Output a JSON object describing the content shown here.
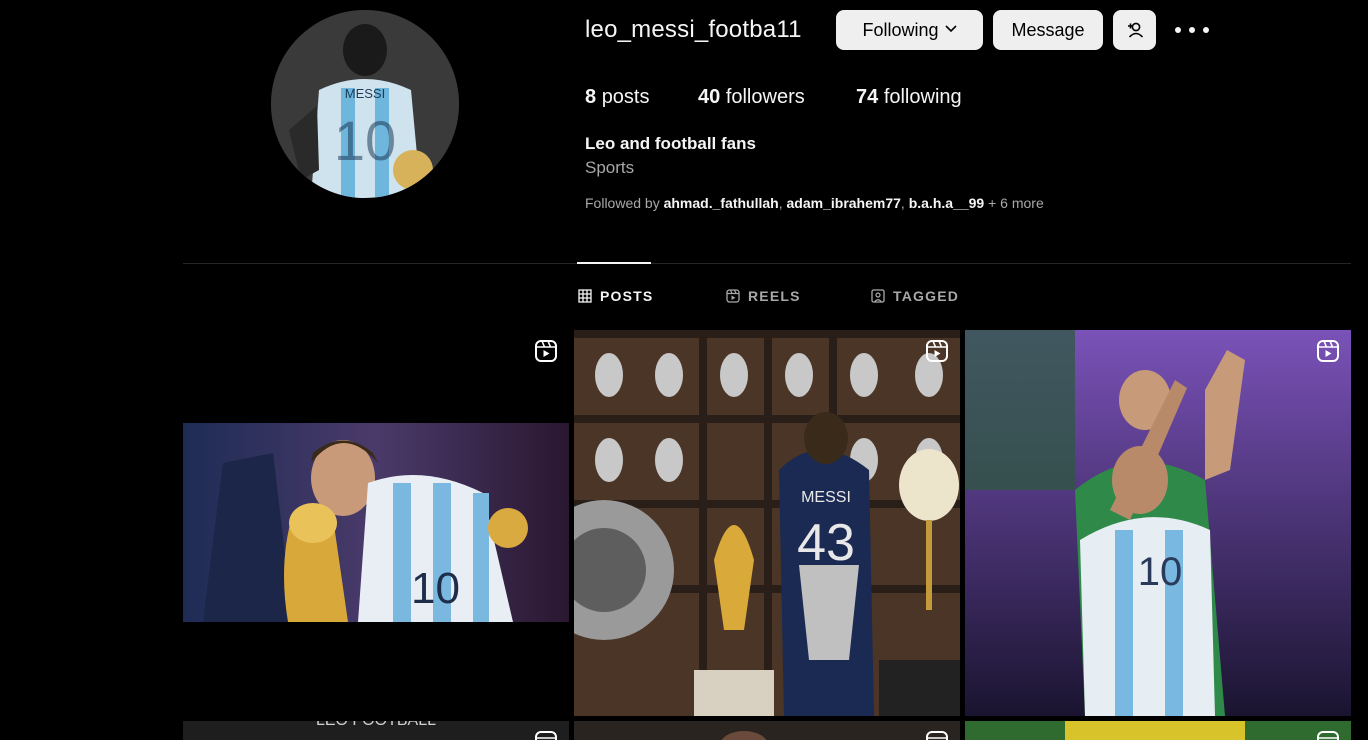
{
  "profile": {
    "username": "leo_messi_footba11",
    "following_label": "Following",
    "message_label": "Message",
    "avatar_shirt_text": "MESSI",
    "stats": {
      "posts_count": "8",
      "posts_label": "posts",
      "followers_count": "40",
      "followers_label": "followers",
      "following_count": "74",
      "following_label": "following"
    },
    "full_name": "Leo and football fans",
    "category": "Sports",
    "followed_by": {
      "prefix": "Followed by",
      "users": [
        "ahmad._fathullah",
        "adam_ibrahem77",
        "b.a.h.a__99"
      ],
      "more": "+ 6 more"
    }
  },
  "tabs": [
    {
      "label": "POSTS",
      "icon": "grid-icon",
      "active": true
    },
    {
      "label": "REELS",
      "icon": "reels-icon",
      "active": false
    },
    {
      "label": "TAGGED",
      "icon": "tagged-icon",
      "active": false
    }
  ],
  "posts": [
    {
      "type": "reel",
      "jersey_number": "10"
    },
    {
      "type": "reel",
      "shirt_name": "MESSI",
      "jersey_number": "43"
    },
    {
      "type": "reel",
      "jersey_number": "10"
    },
    {
      "type": "reel",
      "overlay_text": "LEO   FOOTBALL"
    },
    {
      "type": "reel"
    },
    {
      "type": "reel"
    }
  ],
  "colors": {
    "background": "#000000",
    "button_bg": "#efefef",
    "secondary_text": "#a8a8a8",
    "divider": "#262626"
  }
}
